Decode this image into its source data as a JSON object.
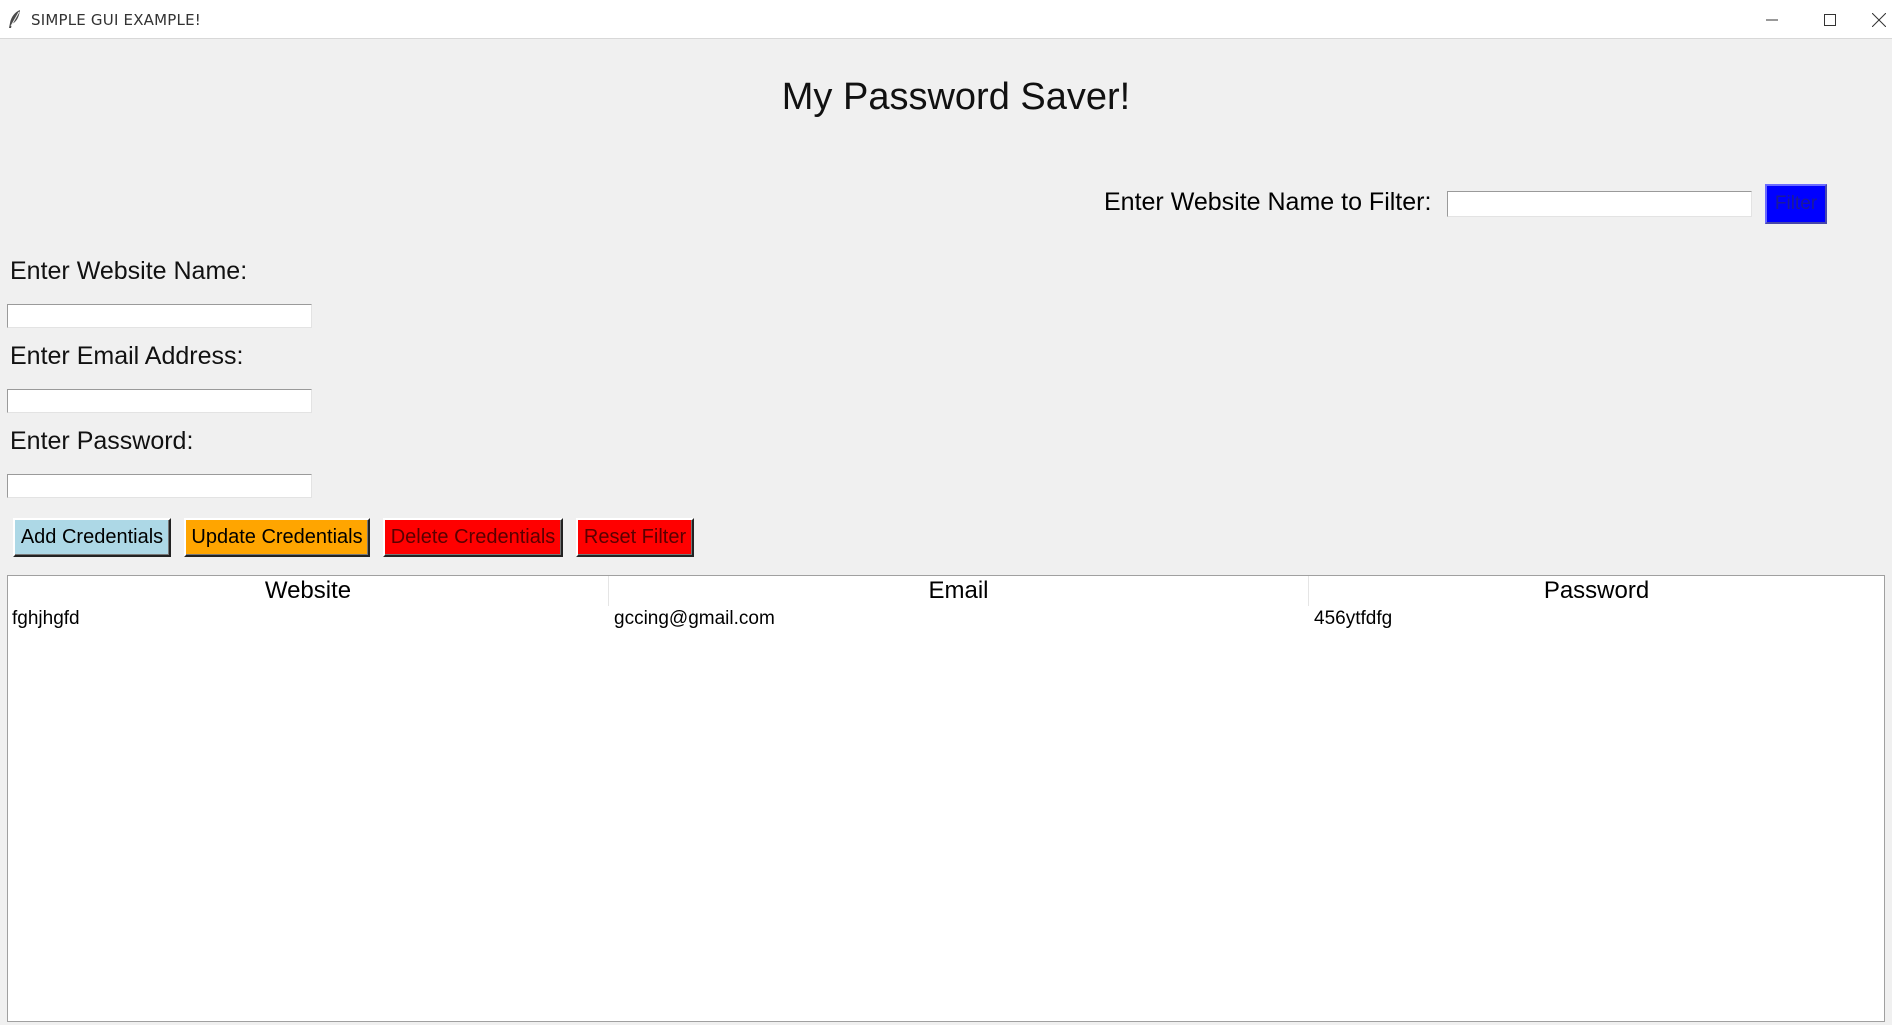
{
  "window": {
    "title": "SIMPLE GUI EXAMPLE!",
    "minimize_icon": "minimize-icon",
    "maximize_icon": "maximize-icon",
    "close_icon": "close-icon",
    "app_icon": "feather-icon"
  },
  "heading": "My Password Saver!",
  "filter": {
    "label": "Enter Website Name to Filter:",
    "value": "",
    "button_label": "Filter",
    "button_color": "#0000ff"
  },
  "form": {
    "website_label": "Enter Website Name:",
    "website_value": "",
    "email_label": "Enter Email Address:",
    "email_value": "",
    "password_label": "Enter Password:",
    "password_value": ""
  },
  "actions": {
    "add_label": "Add Credentials",
    "update_label": "Update Credentials",
    "delete_label": "Delete Credentials",
    "reset_label": "Reset Filter",
    "add_color": "#add8e6",
    "update_color": "#ffa500",
    "delete_color": "#ff0000",
    "reset_color": "#ff0000"
  },
  "table": {
    "columns": [
      "Website",
      "Email",
      "Password"
    ],
    "rows": [
      [
        "fghjhgfd",
        "gccing@gmail.com",
        "456ytfdfg"
      ]
    ]
  }
}
